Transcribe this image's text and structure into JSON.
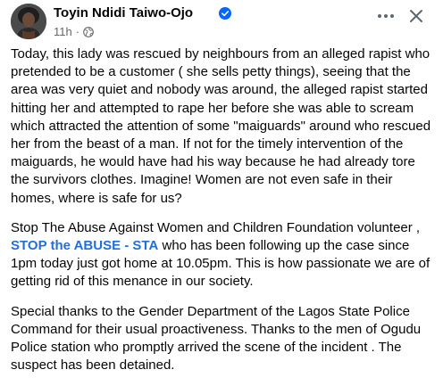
{
  "post": {
    "author_name": "Toyin Ndidi Taiwo-Ojo",
    "timestamp": "11h",
    "separator": "·",
    "paragraph_1": "Today, this lady was rescued by neighbours from an alleged rapist who pretended to be a customer ( she sells petty things), seeing that the area was very quiet and nobody was around, the alleged rapist started hitting her and attempted to rape her before she was able to scream which attracted the attention of some \"maiguards\" around  who rescued her from the beast of a man. If not for the timely intervention of the maiguards, he would have had his way because he had already tore the survivors clothes.  Imagine! Women are not even safe in their homes, where is safe for us?",
    "paragraph_2_before": "Stop The Abuse Against Women and Children Foundation volunteer ,",
    "paragraph_2_mention": "STOP the ABUSE - STA",
    "paragraph_2_after": "who has been following up the case since 1pm today just got home at 10.05pm. This is how passionate we are of getting rid of this menance in our society.",
    "paragraph_3": "Special thanks to the Gender Department of the Lagos State Police Command for their usual proactiveness.  Thanks to the men of Ogudu Police station who promptly arrived the scene of the incident . The suspect has been detained."
  },
  "icons": {
    "verified": "verified-badge-icon",
    "audience": "globe-icon",
    "more": "more-options-icon",
    "close": "close-icon"
  },
  "colors": {
    "text": "#050505",
    "secondary_text": "#65676b",
    "mention": "#216fdb",
    "verified": "#0866ff"
  }
}
